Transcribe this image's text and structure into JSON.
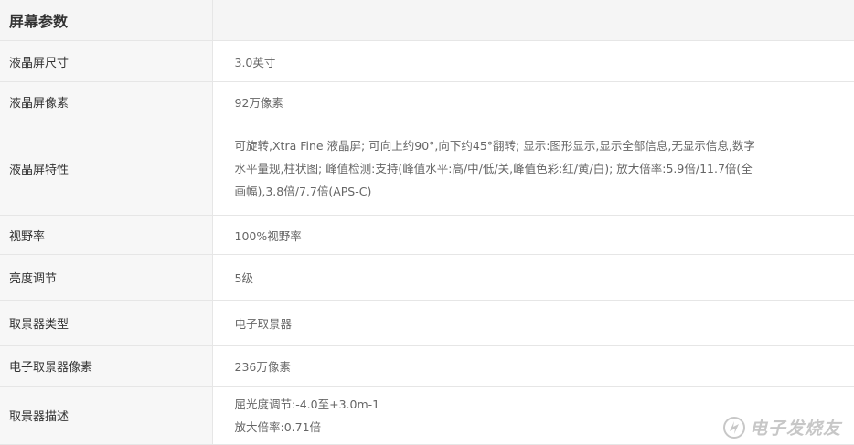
{
  "section": {
    "title": "屏幕参数"
  },
  "rows": [
    {
      "label": "液晶屏尺寸",
      "value": "3.0英寸"
    },
    {
      "label": "液晶屏像素",
      "value": "92万像素"
    },
    {
      "label": "液晶屏特性",
      "lines": [
        "可旋转,Xtra Fine 液晶屏; 可向上约90°,向下约45°翻转; 显示:图形显示,显示全部信息,无显示信息,数字",
        "水平量规,柱状图; 峰值检测:支持(峰值水平:高/中/低/关,峰值色彩:红/黄/白); 放大倍率:5.9倍/11.7倍(全",
        "画幅),3.8倍/7.7倍(APS-C)"
      ]
    },
    {
      "label": "视野率",
      "value": "100%视野率"
    },
    {
      "label": "亮度调节",
      "value": "5级"
    },
    {
      "label": "取景器类型",
      "value": "电子取景器"
    },
    {
      "label": "电子取景器像素",
      "value": "236万像素"
    },
    {
      "label": "取景器描述",
      "lines": [
        "屈光度调节:-4.0至+3.0m-1",
        "放大倍率:0.71倍"
      ]
    }
  ],
  "watermark": {
    "text": "电子发烧友"
  }
}
